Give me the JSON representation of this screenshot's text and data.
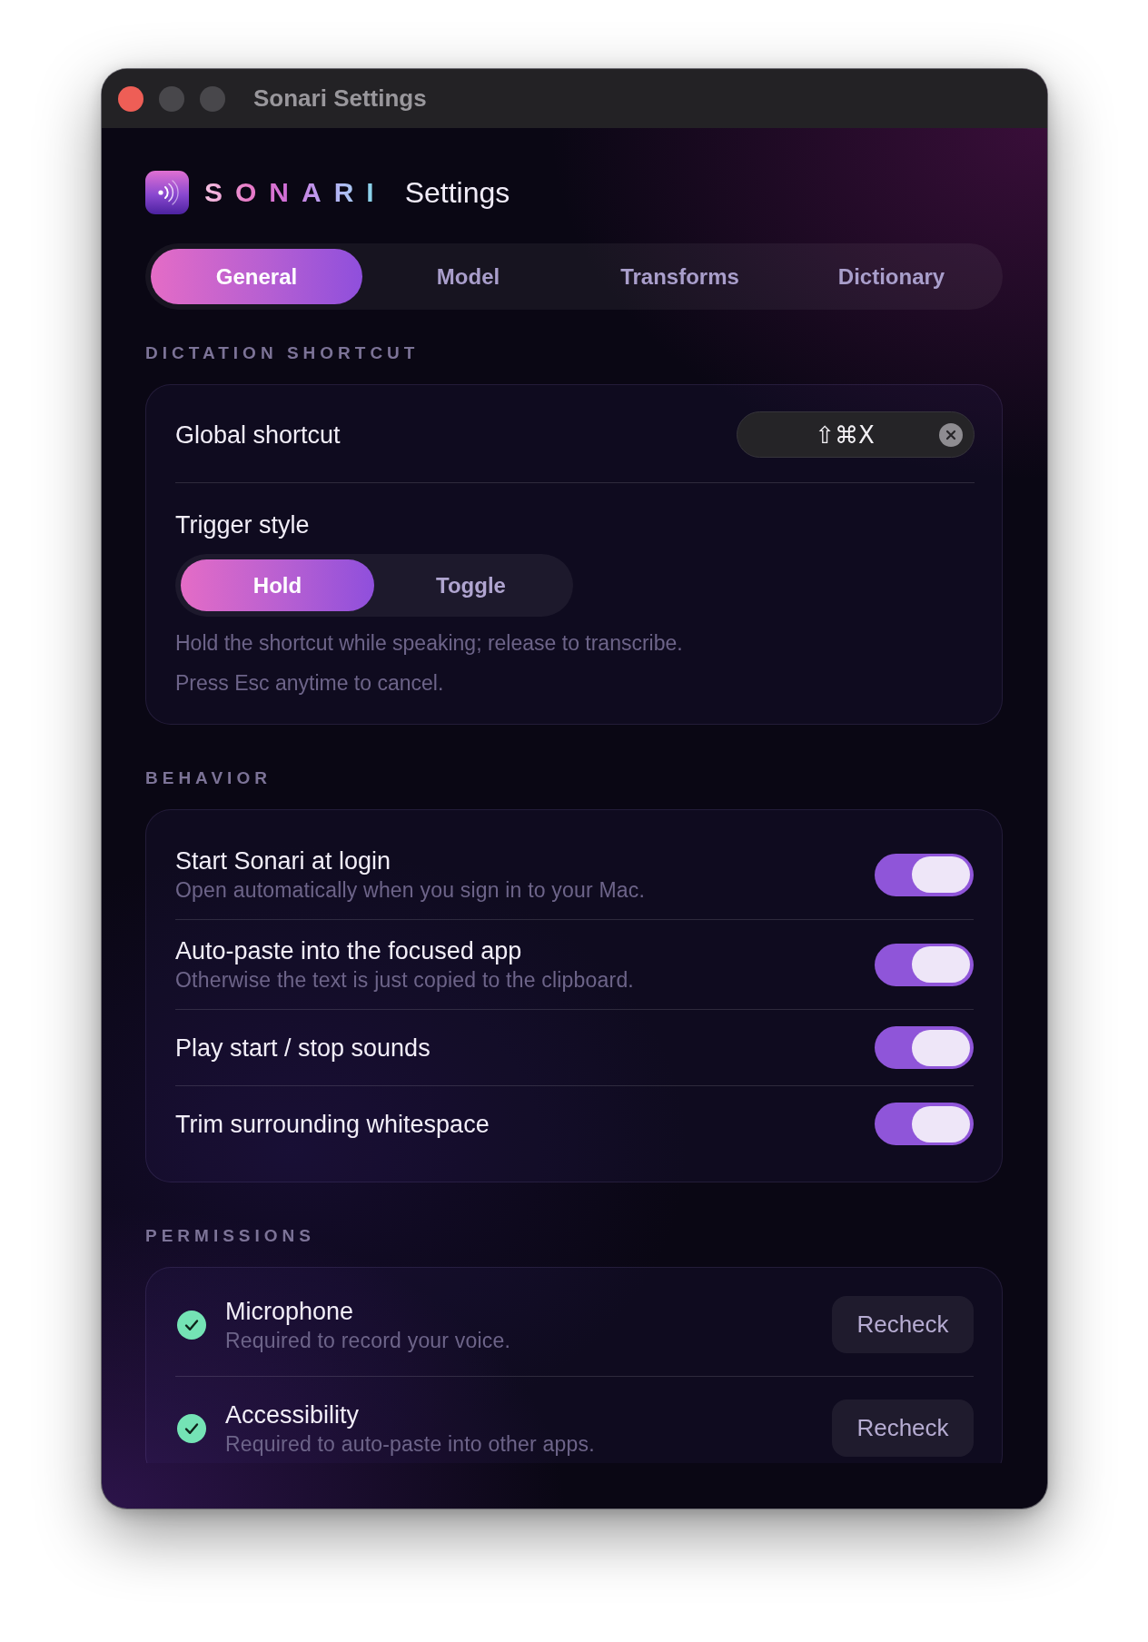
{
  "window": {
    "title": "Sonari Settings",
    "controls": [
      {
        "kind": "close",
        "disabled": false
      },
      {
        "kind": "minimize",
        "disabled": true
      },
      {
        "kind": "zoom",
        "disabled": true
      }
    ]
  },
  "header": {
    "brand": "SONARI",
    "title": "Settings"
  },
  "tabs": [
    {
      "label": "General",
      "selected": true
    },
    {
      "label": "Model",
      "selected": false
    },
    {
      "label": "Transforms",
      "selected": false
    },
    {
      "label": "Dictionary",
      "selected": false
    }
  ],
  "sections": [
    {
      "kind": "shortcut",
      "heading": "DICTATION SHORTCUT",
      "shortcut": {
        "label": "Global shortcut",
        "value": "⇧⌘X"
      },
      "trigger": {
        "label": "Trigger style",
        "options": [
          {
            "label": "Hold",
            "selected": true
          },
          {
            "label": "Toggle",
            "selected": false
          }
        ]
      },
      "notes": [
        "Hold the shortcut while speaking; release to transcribe.",
        "Press Esc anytime to cancel."
      ]
    },
    {
      "kind": "toggles",
      "heading": "BEHAVIOR",
      "items": [
        {
          "title": "Start Sonari at login",
          "subtitle": "Open automatically when you sign in to your Mac.",
          "on": true
        },
        {
          "title": "Auto-paste into the focused app",
          "subtitle": "Otherwise the text is just copied to the clipboard.",
          "on": true
        },
        {
          "title": "Play start / stop sounds",
          "on": true
        },
        {
          "title": "Trim surrounding whitespace",
          "on": true
        }
      ]
    },
    {
      "kind": "permissions",
      "heading": "PERMISSIONS",
      "items": [
        {
          "name": "Microphone",
          "description": "Required to record your voice.",
          "granted": true,
          "button": "Recheck"
        },
        {
          "name": "Accessibility",
          "description": "Required to auto-paste into other apps.",
          "granted": true,
          "button": "Recheck"
        }
      ]
    }
  ]
}
